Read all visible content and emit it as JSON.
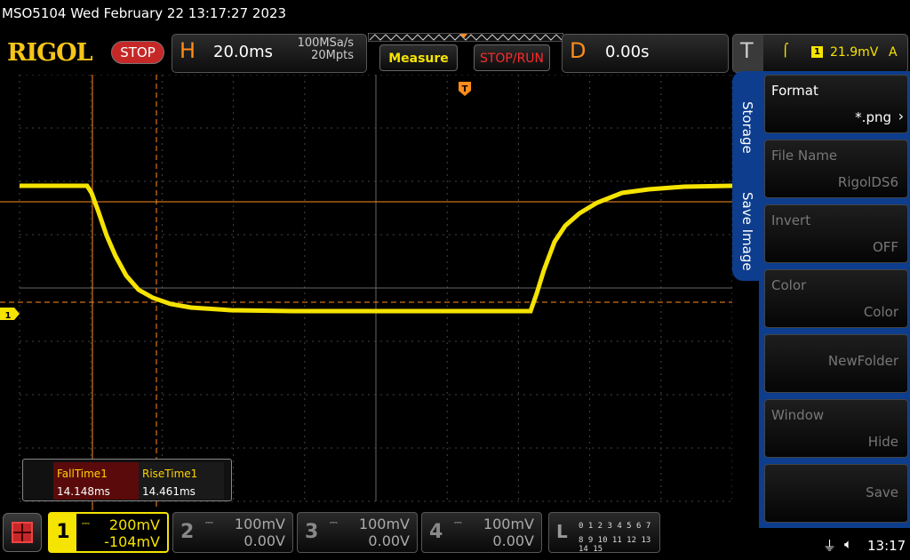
{
  "title": "MSO5104  Wed February 22 13:17:27 2023",
  "header": {
    "logo": "RIGOL",
    "run_state": "STOP",
    "horizontal_letter": "H",
    "timebase": "20.0ms",
    "sample_rate": "100MSa/s",
    "memory_depth": "20Mpts",
    "measure_label": "Measure",
    "stop_run_label": "STOP/RUN",
    "delay_letter": "D",
    "delay_value": "0.00s",
    "trigger_letter": "T",
    "trigger_channel": "1",
    "trigger_level": "21.9mV",
    "trigger_mode": "A"
  },
  "side_menu": {
    "tabs": [
      "Storage",
      "Save Image"
    ],
    "items": [
      {
        "title": "Format",
        "value": "*.png",
        "enabled": true
      },
      {
        "title": "File Name",
        "value": "RigolDS6",
        "enabled": false
      },
      {
        "title": "Invert",
        "value": "OFF",
        "enabled": false
      },
      {
        "title": "Color",
        "value": "Color",
        "enabled": false
      },
      {
        "title": "",
        "value": "NewFolder",
        "enabled": false
      },
      {
        "title": "Window",
        "value": "Hide",
        "enabled": false
      },
      {
        "title": "",
        "value": "Save",
        "enabled": false
      }
    ]
  },
  "measurements": [
    {
      "name": "FallTime1",
      "value": "14.148ms"
    },
    {
      "name": "RiseTime1",
      "value": "14.461ms"
    }
  ],
  "channels": [
    {
      "num": "1",
      "coupling": "DC",
      "scale": "200mV",
      "offset": "-104mV",
      "active": true
    },
    {
      "num": "2",
      "coupling": "DC",
      "scale": "100mV",
      "offset": "0.00V",
      "active": false
    },
    {
      "num": "3",
      "coupling": "DC",
      "scale": "100mV",
      "offset": "0.00V",
      "active": false
    },
    {
      "num": "4",
      "coupling": "DC",
      "scale": "100mV",
      "offset": "0.00V",
      "active": false
    }
  ],
  "logic": {
    "letter": "L",
    "row1": "0 1 2 3   4 5 6 7",
    "row2": "8 9 10 11  12 13 14 15"
  },
  "status": {
    "time": "13:17"
  },
  "colors": {
    "ch1": "#f5e300",
    "cursor": "#ff8c1a",
    "menu_blue": "#0d3d8c",
    "stop_red": "#c62828"
  },
  "channel_marker": "1",
  "trigger_marker": "T"
}
